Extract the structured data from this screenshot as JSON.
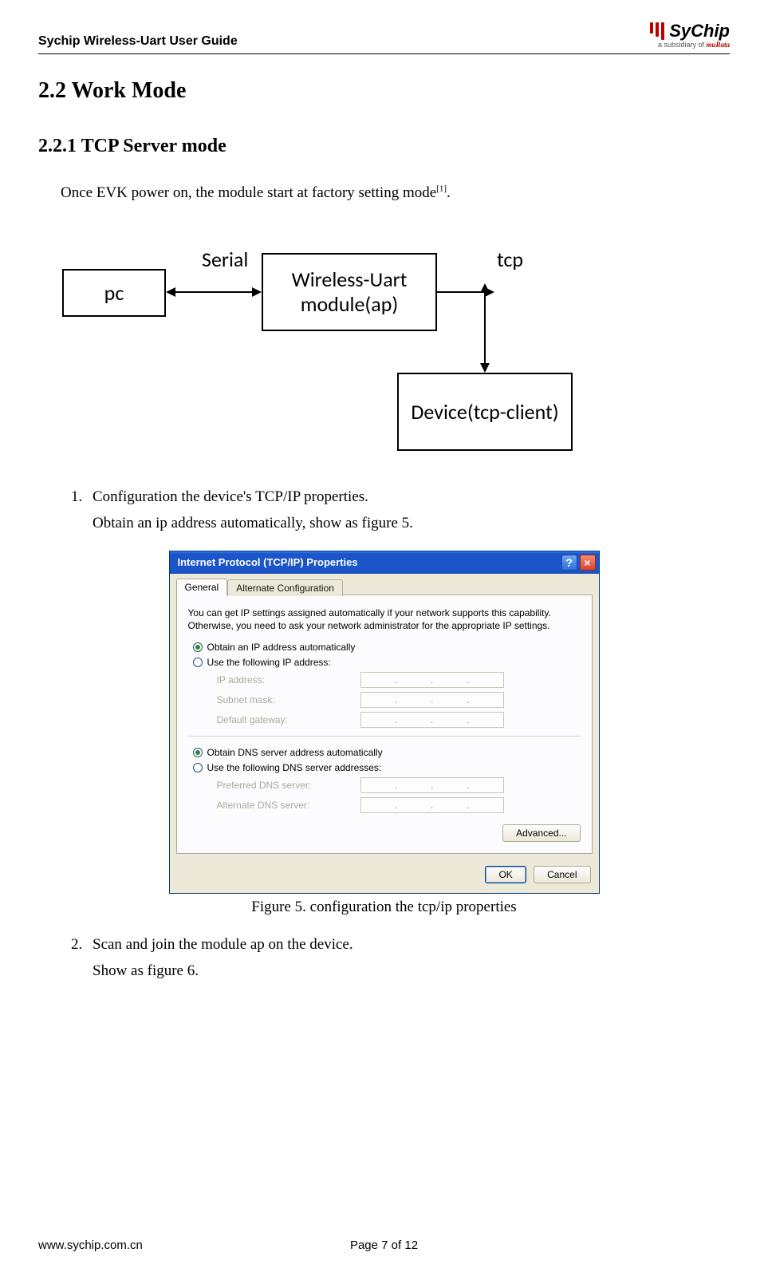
{
  "header": {
    "doc_title": "Sychip Wireless-Uart User Guide",
    "logo_text": "SyChip",
    "logo_sub_prefix": "a subsidiary of ",
    "logo_sub_brand": "muRata"
  },
  "section": {
    "h1": "2.2 Work Mode",
    "h2": "2.2.1 TCP Server mode",
    "intro_a": "Once EVK power on, the module start at factory setting mode",
    "intro_ref": "[1]",
    "intro_b": "."
  },
  "diagram": {
    "pc": "pc",
    "serial": "Serial",
    "module": "Wireless-Uart module(ap)",
    "tcp": "tcp",
    "device": "Device(tcp-client)"
  },
  "steps": {
    "one_a": "Configuration the device's TCP/IP properties.",
    "one_b": "Obtain an ip address automatically, show as figure 5.",
    "two_a": "Scan and join the module ap on the device.",
    "two_b": "Show as figure 6."
  },
  "figure_caption": "Figure 5. configuration the tcp/ip properties",
  "dialog": {
    "title": "Internet Protocol (TCP/IP) Properties",
    "tabs": {
      "general": "General",
      "alt": "Alternate Configuration"
    },
    "desc": "You can get IP settings assigned automatically if your network supports this capability. Otherwise, you need to ask your network administrator for the appropriate IP settings.",
    "radio_obtain_ip": "Obtain an IP address automatically",
    "radio_use_ip": "Use the following IP address:",
    "fields": {
      "ip": "IP address:",
      "subnet": "Subnet mask:",
      "gateway": "Default gateway:",
      "pref_dns": "Preferred DNS server:",
      "alt_dns": "Alternate DNS server:"
    },
    "radio_obtain_dns": "Obtain DNS server address automatically",
    "radio_use_dns": "Use the following DNS server addresses:",
    "advanced_btn": "Advanced...",
    "ok_btn": "OK",
    "cancel_btn": "Cancel"
  },
  "footer": {
    "url": "www.sychip.com.cn",
    "page": "Page 7 of 12"
  }
}
